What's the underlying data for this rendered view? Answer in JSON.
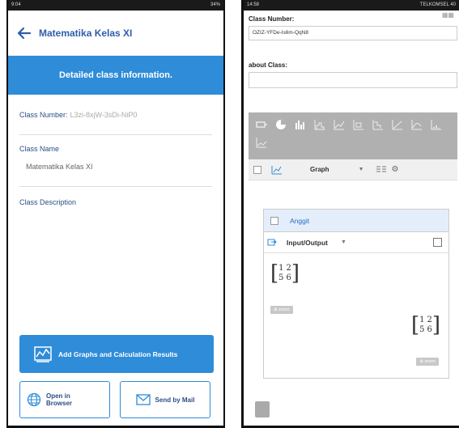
{
  "left": {
    "status_time": "9:04",
    "status_right": "34%",
    "title": "Matematika Kelas XI",
    "banner": "Detailed class information.",
    "class_number_label": "Class Number:",
    "class_number_value": "L3zi-8xjW-3sDi-NiP0",
    "class_name_label": "Class Name",
    "class_name_value": "Matematika Kelas XI",
    "class_description_label": "Class Description",
    "add_graphs_label": "Add Graphs and Calculation Results",
    "open_browser_line1": "Open in",
    "open_browser_line2": "Browser",
    "send_mail_label": "Send by Mail"
  },
  "right": {
    "status_time": "14:58",
    "status_right": "TELKOMSEL 40",
    "class_number_label": "Class Number:",
    "class_number_value": "OZIZ-YFDe-Is6m-QqN8",
    "about_label": "about Class:",
    "graph_label": "Graph",
    "object_name": "Anggit",
    "io_label": "Input/Output",
    "zoom_label": "zoom",
    "matrix": [
      [
        "1",
        "2"
      ],
      [
        "5",
        "6"
      ]
    ]
  },
  "colors": {
    "accent": "#2f8cd8",
    "text_blue": "#2c4e86",
    "toolbar_gray": "#b0b0b0"
  }
}
